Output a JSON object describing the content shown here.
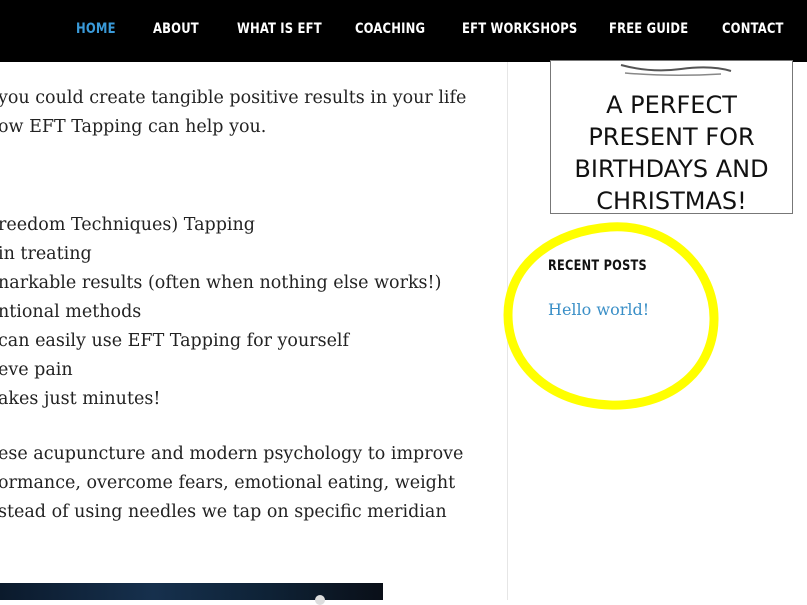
{
  "nav": {
    "items": [
      "HOME",
      "ABOUT",
      "WHAT IS EFT",
      "COACHING",
      "EFT WORKSHOPS",
      "FREE GUIDE",
      "CONTACT"
    ]
  },
  "content": {
    "lines": [
      "you could create tangible positive results in your life",
      "ow EFT Tapping can help you.",
      "reedom Techniques) Tapping",
      "in treating",
      "narkable results (often when nothing else works!)",
      "ntional methods",
      "can easily use EFT Tapping for yourself",
      "eve pain",
      "akes just minutes!",
      "ese acupuncture and modern psychology to improve",
      "ormance, overcome fears, emotional eating, weight",
      "stead of using needles we tap on specific meridian"
    ]
  },
  "sidebar": {
    "promo_text": "A PERFECT\nPRESENT FOR\nBIRTHDAYS AND\nCHRISTMAS!",
    "recent_posts_title": "RECENT POSTS",
    "recent_posts": [
      "Hello world!"
    ],
    "highlight_color": "#ffff00"
  },
  "colors": {
    "nav_bg": "#000000",
    "nav_active": "#3a9ad9",
    "link": "#3a8fc7"
  }
}
